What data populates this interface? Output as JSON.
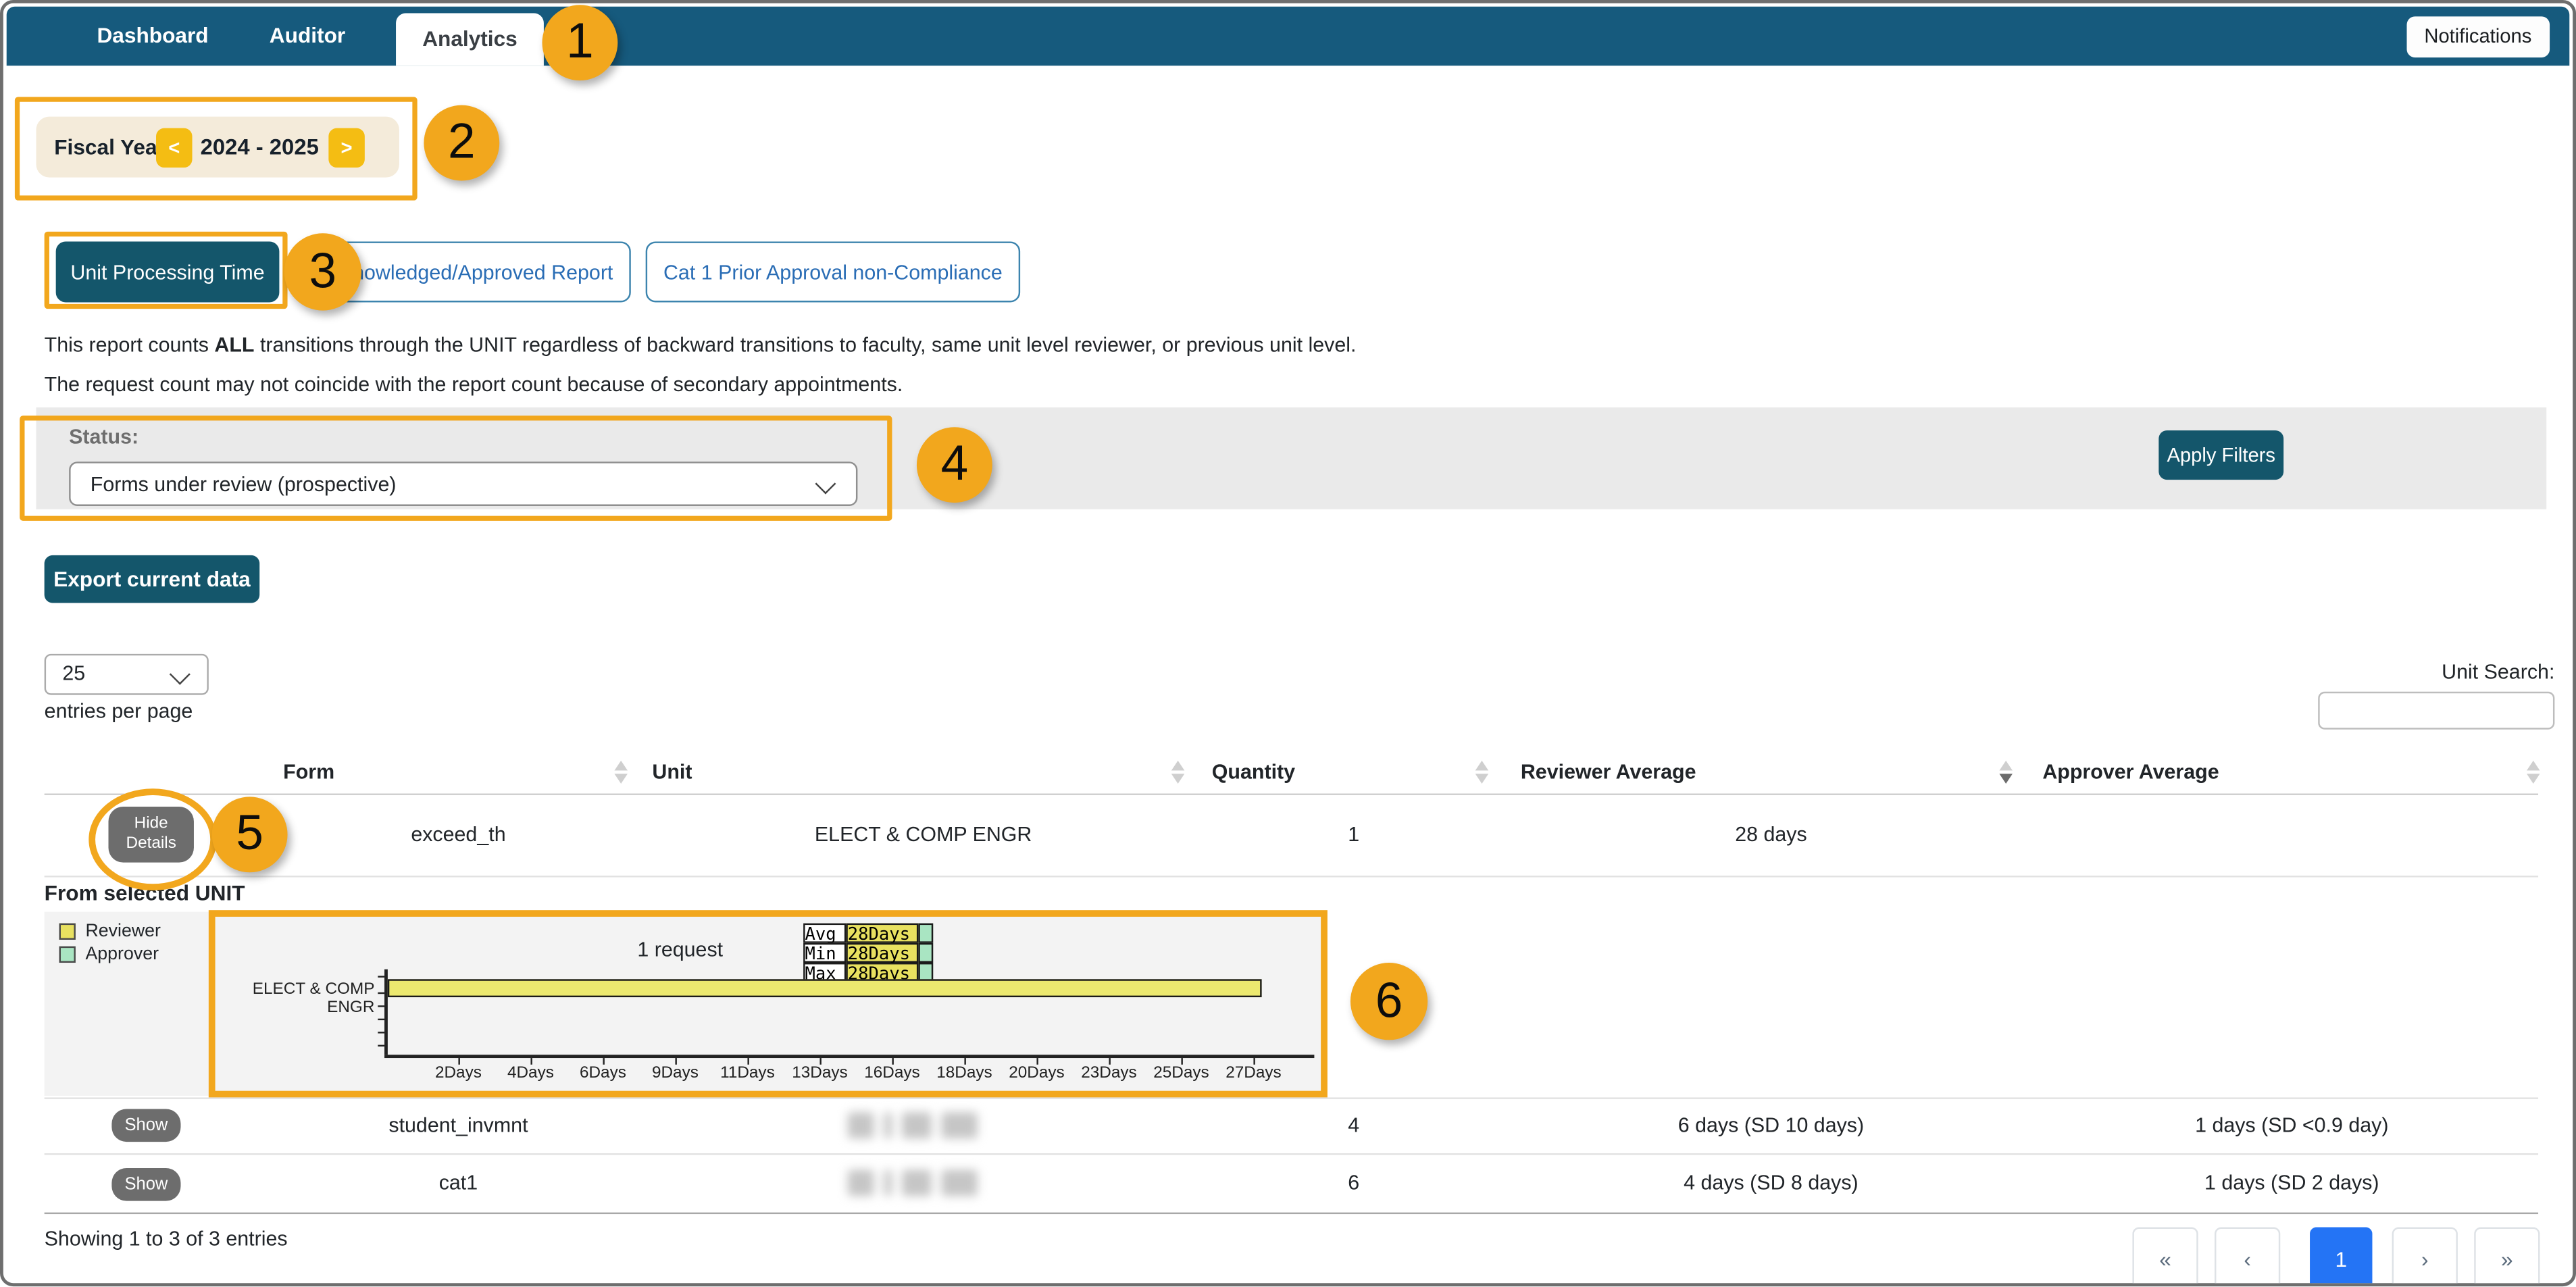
{
  "nav": {
    "tabs": [
      {
        "label": "Dashboard",
        "active": false
      },
      {
        "label": "Auditor",
        "active": false
      },
      {
        "label": "Analytics",
        "active": true
      }
    ],
    "notifications_label": "Notifications"
  },
  "fiscal_year": {
    "label": "Fiscal Year:",
    "value": "2024 - 2025",
    "prev_glyph": "<",
    "next_glyph": ">"
  },
  "report_tabs": [
    {
      "label": "Unit Processing Time",
      "active": true
    },
    {
      "label": "Acknowledged/Approved Report",
      "active": false
    },
    {
      "label": "Cat 1 Prior Approval non-Compliance",
      "active": false
    }
  ],
  "description": {
    "line1_prefix": "This report counts ",
    "line1_bold": "ALL",
    "line1_suffix": " transitions through the UNIT regardless of backward transitions to faculty, same unit level reviewer, or previous unit level.",
    "line2": "The request count may not coincide with the report count because of secondary appointments."
  },
  "filters": {
    "status_label": "Status:",
    "status_value": "Forms under review (prospective)",
    "apply_label": "Apply Filters"
  },
  "toolbar": {
    "export_label": "Export current data",
    "entries_value": "25",
    "entries_suffix": "entries per page",
    "unit_search_label": "Unit Search:",
    "unit_search_value": ""
  },
  "table": {
    "headers": [
      "Form",
      "Unit",
      "Quantity",
      "Reviewer Average",
      "Approver Average"
    ],
    "rows": [
      {
        "toggle": "Hide Details",
        "form": "exceed_th",
        "unit": "ELECT & COMP ENGR",
        "unit_redacted": false,
        "quantity": "1",
        "reviewer_avg": "28 days",
        "approver_avg": "",
        "expanded": true
      },
      {
        "toggle": "Show",
        "form": "student_invmnt",
        "unit": "",
        "unit_redacted": true,
        "quantity": "4",
        "reviewer_avg": "6 days (SD 10 days)",
        "approver_avg": "1 days (SD <0.9 day)",
        "expanded": false
      },
      {
        "toggle": "Show",
        "form": "cat1",
        "unit": "",
        "unit_redacted": true,
        "quantity": "6",
        "reviewer_avg": "4 days (SD 8 days)",
        "approver_avg": "1 days (SD 2 days)",
        "expanded": false
      }
    ],
    "summary": "Showing 1 to 3 of 3 entries"
  },
  "details": {
    "heading": "From selected UNIT",
    "legend": [
      {
        "label": "Reviewer",
        "color": "#E8E160"
      },
      {
        "label": "Approver",
        "color": "#A9E5C2"
      }
    ],
    "chart_data": {
      "type": "bar",
      "orientation": "horizontal",
      "title": "1 request",
      "categories": [
        "ELECT & COMP ENGR"
      ],
      "series": [
        {
          "name": "Reviewer",
          "color": "#ECE96F",
          "values_days": [
            28
          ]
        },
        {
          "name": "Approver",
          "color": "#A9E5C2",
          "values_days": [
            0
          ]
        }
      ],
      "stats": [
        {
          "label": "Avg",
          "value": "28Days"
        },
        {
          "label": "Min",
          "value": "28Days"
        },
        {
          "label": "Max",
          "value": "28Days"
        }
      ],
      "x_tick_labels": [
        "2Days",
        "4Days",
        "6Days",
        "9Days",
        "11Days",
        "13Days",
        "16Days",
        "18Days",
        "20Days",
        "23Days",
        "25Days",
        "27Days"
      ],
      "xlim_days": [
        0,
        28
      ],
      "grid": false,
      "legend_position": "left"
    }
  },
  "pagination": {
    "first": "«",
    "prev": "‹",
    "page": "1",
    "active_page": "1",
    "next": "›",
    "last": "»"
  },
  "callouts": {
    "c1": "1",
    "c2": "2",
    "c3": "3",
    "c4": "4",
    "c5": "5",
    "c6": "6"
  },
  "colors": {
    "nav_blue": "#165A7D",
    "teal_button": "#14566B",
    "callout_orange": "#F2A71D",
    "fiscal_gold": "#F4BD13",
    "bar_yellow": "#ECE96F",
    "approver_green": "#A9E5C2",
    "active_page_blue": "#2474F5"
  }
}
